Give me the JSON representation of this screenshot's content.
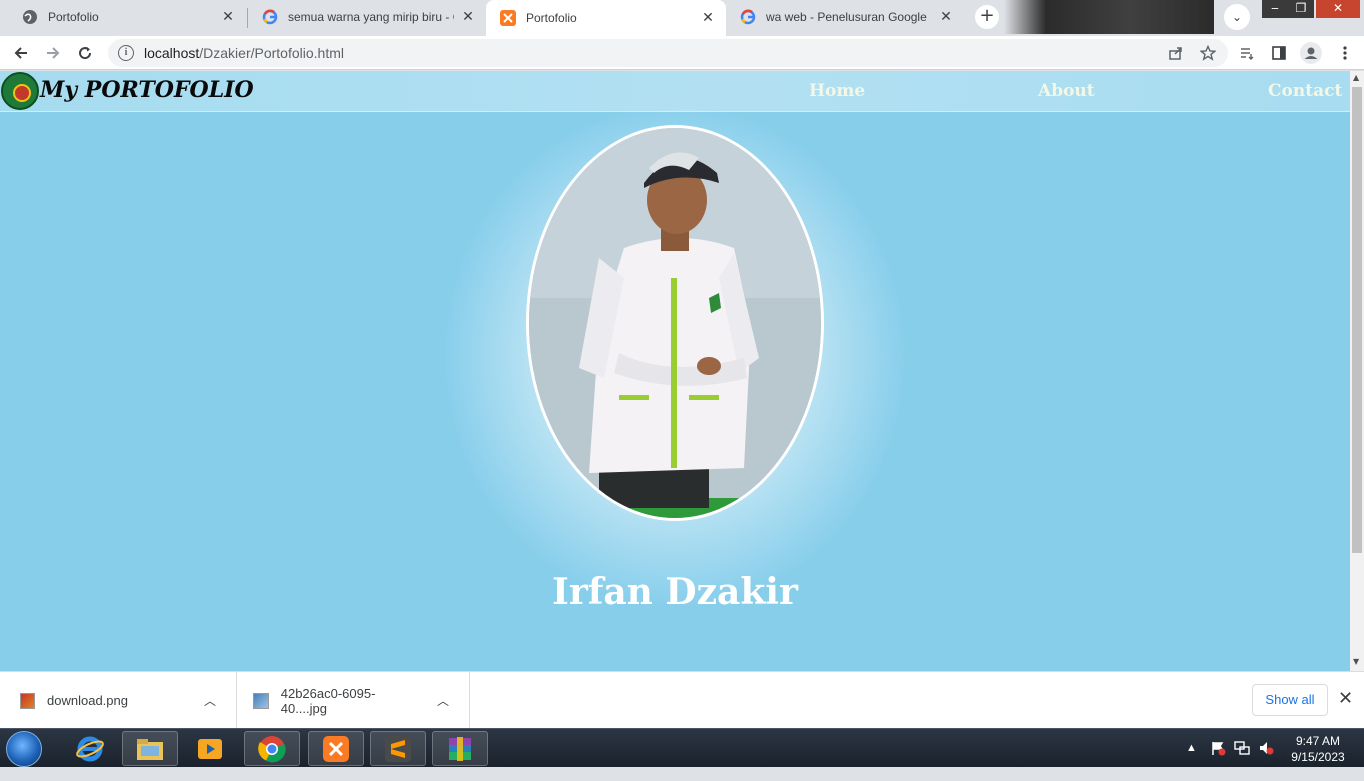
{
  "browser": {
    "tabs": [
      {
        "title": "Portofolio",
        "icon": "globe-icon",
        "active": false
      },
      {
        "title": "semua warna yang mirip biru - G",
        "icon": "google-icon",
        "active": false
      },
      {
        "title": "Portofolio",
        "icon": "xampp-icon",
        "active": true
      },
      {
        "title": "wa web - Penelusuran Google",
        "icon": "google-icon",
        "active": false
      }
    ],
    "url_host": "localhost",
    "url_path": "/Dzakier/Portofolio.html"
  },
  "page": {
    "brand": "My PORTOFOLIO",
    "nav": [
      "Home",
      "About",
      "Contact"
    ],
    "name": "Irfan Dzakir",
    "colors": {
      "background": "#87ceeb",
      "name_text": "#ffffff",
      "nav_text": "#f3f7e8"
    }
  },
  "downloads": {
    "items": [
      {
        "name": "download.png",
        "icon": "png-file-icon"
      },
      {
        "name": "42b26ac0-6095-40....jpg",
        "icon": "jpg-file-icon"
      }
    ],
    "show_all": "Show all"
  },
  "taskbar": {
    "apps": [
      "internet-explorer-icon",
      "file-explorer-icon",
      "media-player-icon",
      "chrome-icon",
      "xampp-icon",
      "sublime-text-icon",
      "winrar-icon"
    ],
    "time": "9:47 AM",
    "date": "9/15/2023"
  }
}
